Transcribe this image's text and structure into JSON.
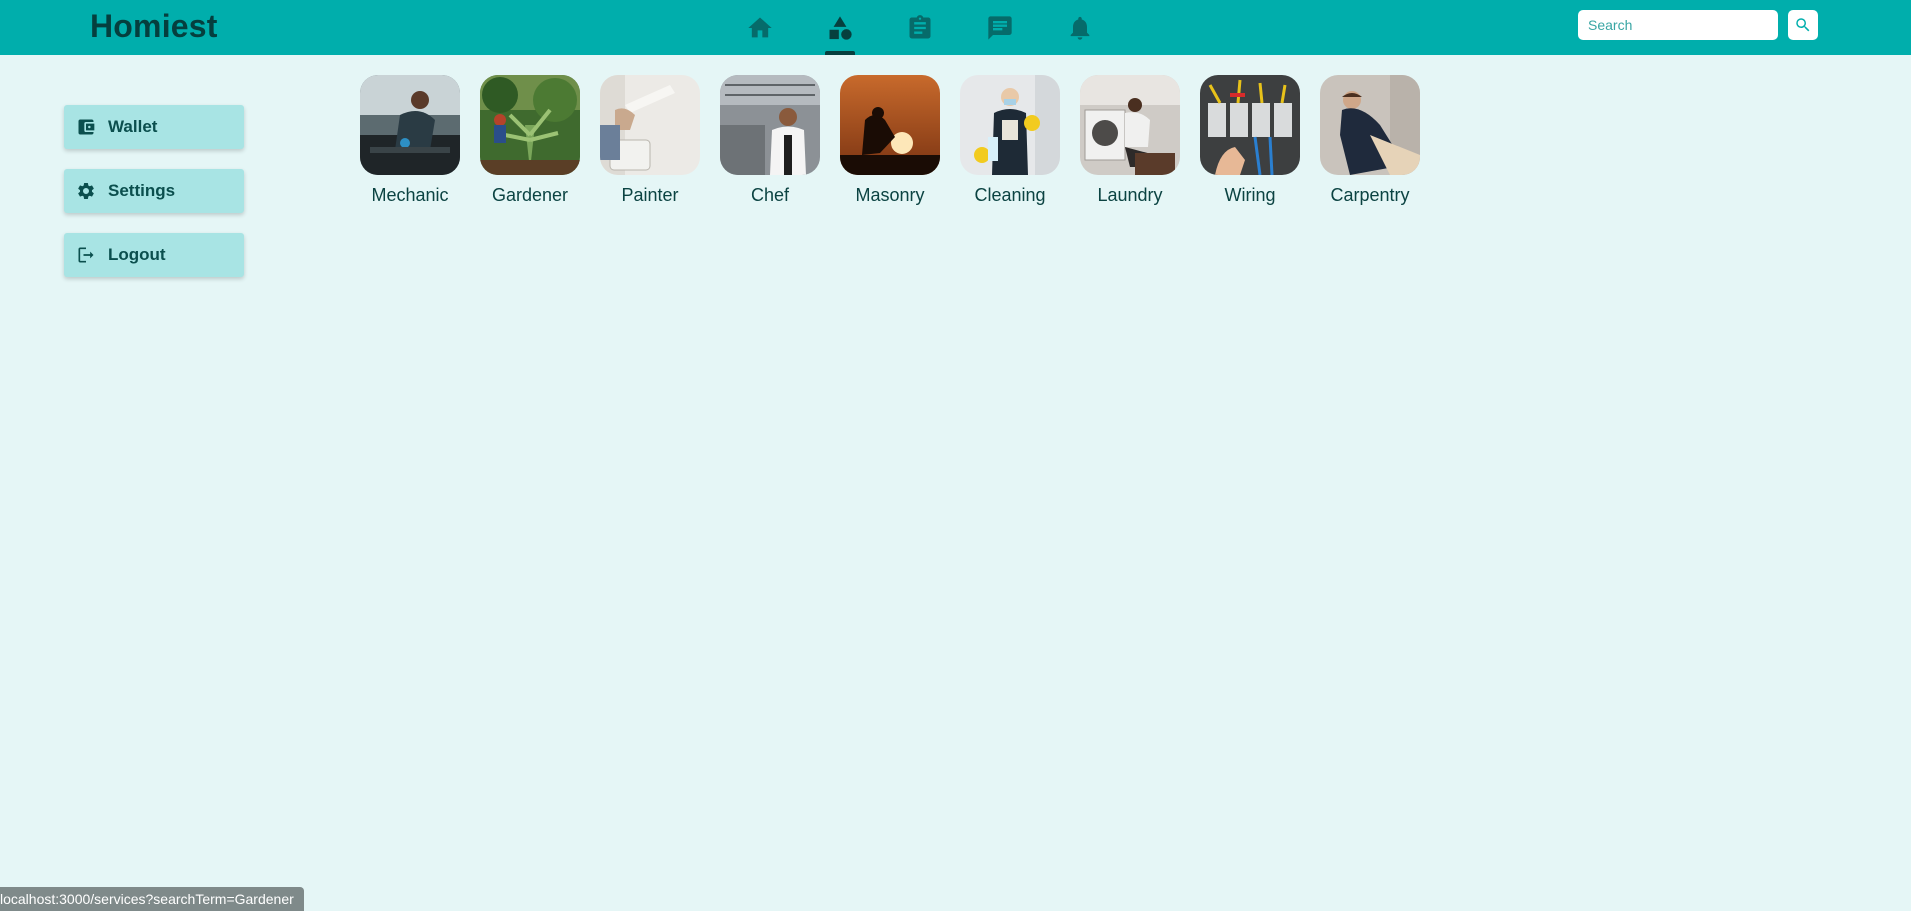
{
  "header": {
    "brand": "Homiest",
    "nav": [
      {
        "icon": "home-icon",
        "active": false
      },
      {
        "icon": "services-icon",
        "active": true
      },
      {
        "icon": "clipboard-icon",
        "active": false
      },
      {
        "icon": "chat-icon",
        "active": false
      },
      {
        "icon": "bell-icon",
        "active": false
      }
    ],
    "search": {
      "placeholder": "Search",
      "value": ""
    }
  },
  "sidebar": {
    "items": [
      {
        "label": "Wallet",
        "icon": "wallet-icon"
      },
      {
        "label": "Settings",
        "icon": "gear-icon"
      },
      {
        "label": "Logout",
        "icon": "logout-icon"
      }
    ]
  },
  "services": [
    {
      "label": "Mechanic"
    },
    {
      "label": "Gardener"
    },
    {
      "label": "Painter"
    },
    {
      "label": "Chef"
    },
    {
      "label": "Masonry"
    },
    {
      "label": "Cleaning"
    },
    {
      "label": "Laundry"
    },
    {
      "label": "Wiring"
    },
    {
      "label": "Carpentry"
    }
  ],
  "statusbar": {
    "url": "localhost:3000/services?searchTerm=Gardener"
  },
  "colors": {
    "header_bg": "#00aeac",
    "page_bg": "#e5f6f6",
    "sidebar_button": "#a8e4e4",
    "text_dark": "#053f3e"
  }
}
